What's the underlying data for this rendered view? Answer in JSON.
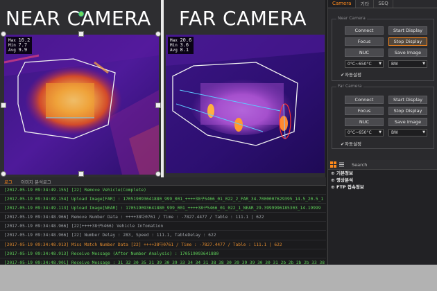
{
  "near_camera": {
    "title": "NEAR CAMERA",
    "stats": {
      "max_label": "Max",
      "max": "16.2",
      "min_label": "Min",
      "min": "7.7",
      "avg_label": "Avg",
      "avg": "9.9"
    }
  },
  "far_camera": {
    "title": "FAR CAMERA",
    "stats": {
      "max_label": "Max",
      "max": "20.6",
      "min_label": "Min",
      "min": "3.6",
      "avg_label": "Avg",
      "avg": "8.1"
    }
  },
  "right_panel": {
    "tabs": [
      "Camera",
      "기타",
      "SEQ"
    ],
    "near": {
      "title": "Near Camera",
      "connect": "Connect",
      "start_display": "Start Display",
      "focus": "Focus",
      "stop_display": "Stop Display",
      "nuc": "NUC",
      "save_image": "Save Image",
      "range": "0°C~650°C",
      "mode": "BW",
      "auto": "자동설정"
    },
    "far": {
      "title": "Far Camera",
      "connect": "Connect",
      "start_display": "Start Display",
      "focus": "Focus",
      "stop_display": "Stop Display",
      "nuc": "NUC",
      "save_image": "Save Image",
      "range": "0°C~650°C",
      "mode": "BW",
      "auto": "자동설정"
    }
  },
  "info_panel": {
    "search_placeholder": "Search",
    "items": [
      "기본정보",
      "영상분석",
      "FTP 접속정보"
    ]
  },
  "log": {
    "tabs": [
      "로그",
      "이미지 분석로그"
    ],
    "lines": [
      {
        "text": "[2017-05-19 09:34:49.155] [22] Remove Vehicle(Complete)",
        "color": "green"
      },
      {
        "text": "[2017-05-19 09:34:49.154] Upload Image[FAR] : 170519093641880_999_001_++++38구5466_01_022_2_FAR_34.7000007629395_14.5_20.5_1",
        "color": "green"
      },
      {
        "text": "[2017-05-19 09:34:49.113] Upload Image[NEAR] : 170519093641880_999_001_++++38구5466_01_022_1_NEAR_29.3999996185303_14.19999",
        "color": "green"
      },
      {
        "text": "[2017-05-19 09:34:48.966] Remove Number Data : ++++38다0761 / Time : -7827.4477 / Table : 111.1 | 622",
        "color": "grey"
      },
      {
        "text": "[2017-05-19 09:34:48.966] [22]++++38구5466) Vehicle Infomation",
        "color": "grey"
      },
      {
        "text": "[2017-05-19 09:34:48.966] [22] Number Delay : 283, Speed : 111.1, TableDelay : 622",
        "color": "grey"
      },
      {
        "text": "[2017-05-19 09:34:48.913] Miss Match Number Data [22] ++++38다0761 / Time : -7827.4477 / Table : 111.1 | 622",
        "color": "orange"
      },
      {
        "text": "[2017-05-19 09:34:48.913] Receive Message (After Number Analysis) : 170519093641880",
        "color": "green"
      },
      {
        "text": "[2017-05-19 09:34:48.901] Receive Message : 31 32 30 35 31 39 30 39 33 34 34 31 38 38 30 39 39 39 30 30 31 2b 2b 2b 2b 33 38 b1 b8",
        "color": "green"
      }
    ]
  }
}
